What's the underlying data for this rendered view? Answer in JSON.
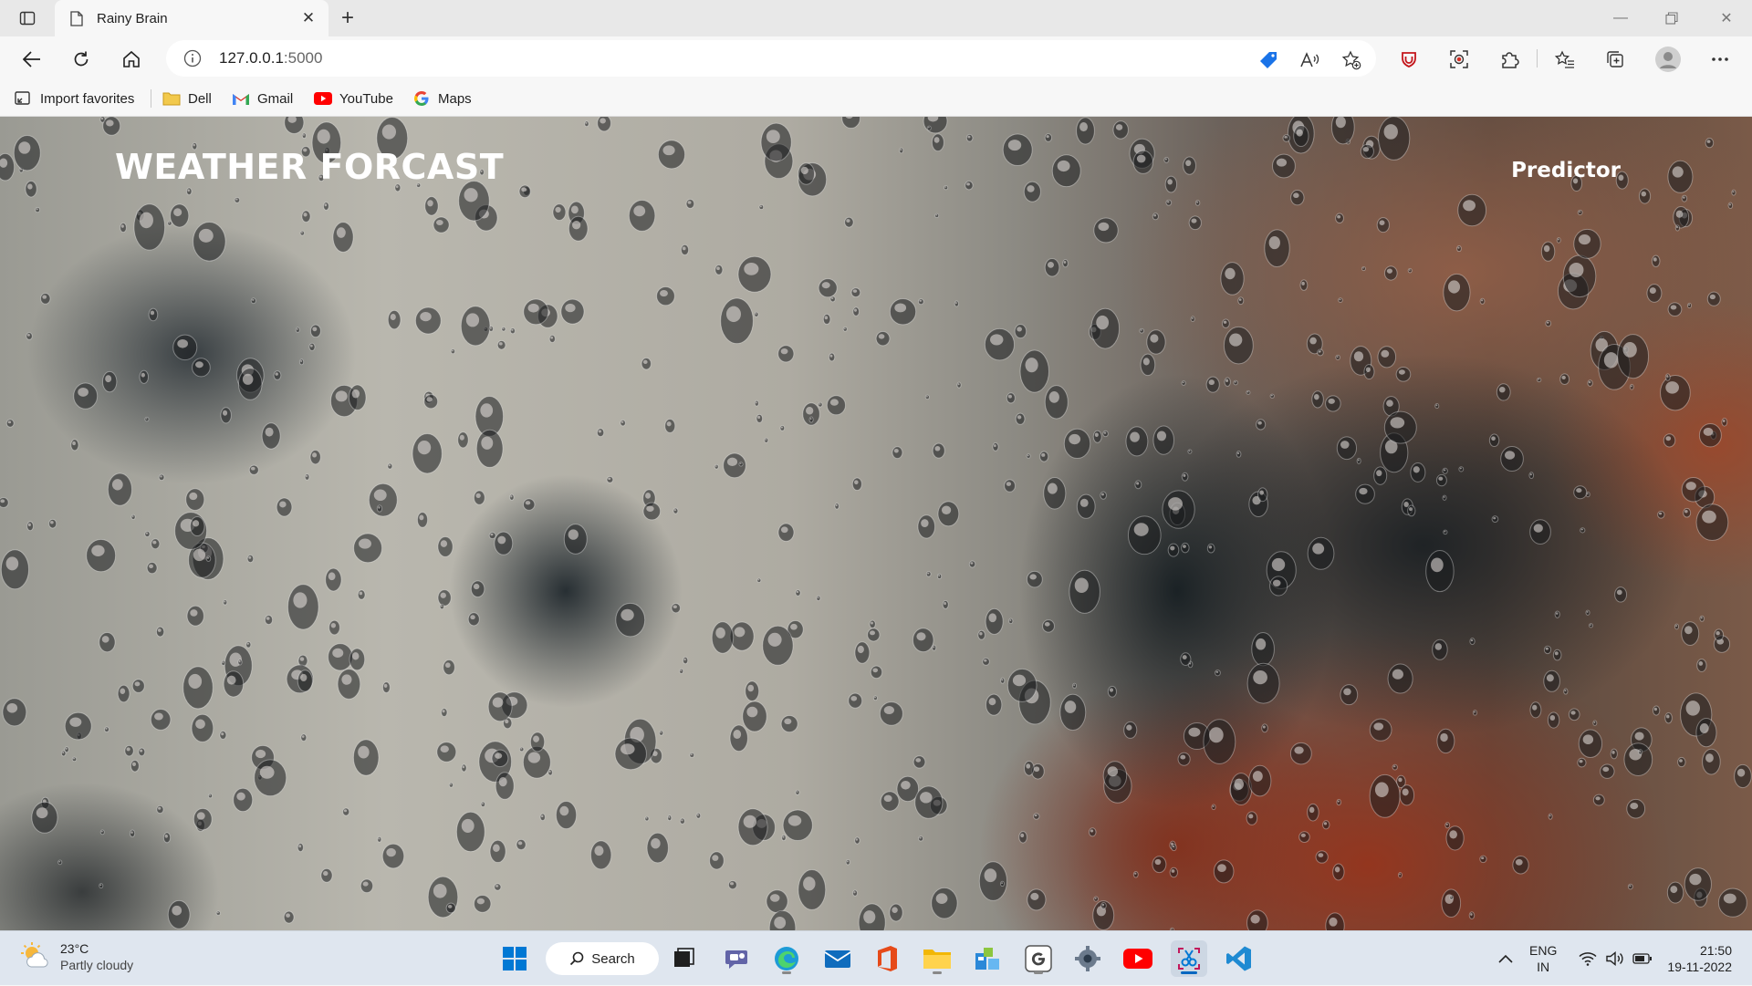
{
  "browser": {
    "tab_title": "Rainy Brain",
    "url_host": "127.0.0.1",
    "url_port": ":5000",
    "favorites": [
      {
        "label": "Import favorites",
        "icon": "import-icon"
      },
      {
        "label": "Dell",
        "icon": "folder-icon"
      },
      {
        "label": "Gmail",
        "icon": "gmail-icon"
      },
      {
        "label": "YouTube",
        "icon": "youtube-icon"
      },
      {
        "label": "Maps",
        "icon": "google-icon"
      }
    ]
  },
  "page": {
    "brand": "WEATHER FORCAST",
    "nav_link": "Predictor",
    "background": "raindrops-on-glass"
  },
  "taskbar": {
    "weather_temp": "23°C",
    "weather_condition": "Partly cloudy",
    "search_label": "Search",
    "lang_top": "ENG",
    "lang_bottom": "IN",
    "time": "21:50",
    "date": "19-11-2022"
  },
  "colors": {
    "accent": "#0067c0",
    "taskbar_bg": "#dfe6ef",
    "tab_bg": "#e8e8e8"
  }
}
